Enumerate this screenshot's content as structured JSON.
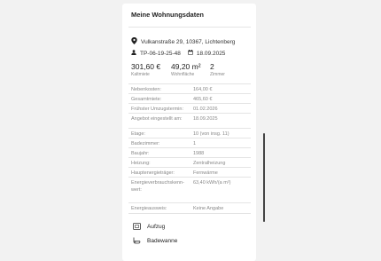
{
  "panel": {
    "title": "Meine Wohnungsdaten",
    "address": "Vulkanstraße 29, 10367, Lichtenberg",
    "reference": "TP-06-19-25-48",
    "date": "18.09.2025"
  },
  "stats": [
    {
      "value": "301,60 €",
      "label": "Kaltmiete"
    },
    {
      "value": "49,20 m²",
      "label": "Wohnfläche"
    },
    {
      "value": "2",
      "label": "Zimmer"
    }
  ],
  "details": [
    {
      "key": "Nebenkosten:",
      "value": "164,00 €"
    },
    {
      "key": "Gesamtmiete:",
      "value": "465,60 €"
    },
    {
      "key": "Frühster Umzugstermin:",
      "value": "01.02.2026"
    },
    {
      "key": "Angebot eingestellt am:",
      "value": "18.09.2025"
    },
    {
      "key": "Etage:",
      "value": "10 (von insg. 11)"
    },
    {
      "key": "Badezimmer:",
      "value": "1"
    },
    {
      "key": "Baujahr:",
      "value": "1988"
    },
    {
      "key": "Heizung:",
      "value": "Zentralheizung"
    },
    {
      "key": "Hauptenergieträger:",
      "value": "Fernwärme"
    },
    {
      "key": "Energieverbrauchskenn-wert:",
      "value": "63,40 kWh/(a m²)"
    },
    {
      "key": "Energieausweis:",
      "value": "Keine Angabe"
    }
  ],
  "features": [
    {
      "label": "Aufzug",
      "icon": "elevator-icon"
    },
    {
      "label": "Badewanne",
      "icon": "bathtub-icon"
    }
  ]
}
